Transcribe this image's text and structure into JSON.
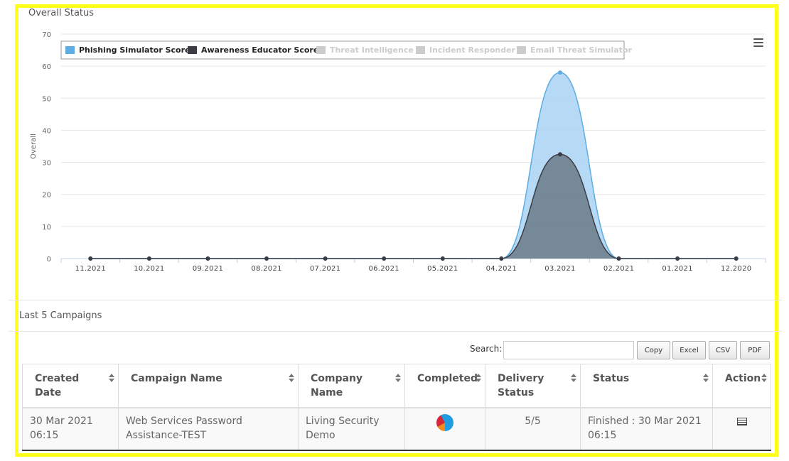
{
  "overall_status": {
    "title": "Overall Status",
    "menu_icon": "hamburger-menu-icon"
  },
  "chart_data": {
    "type": "area",
    "ylabel": "Overall",
    "ylim": [
      0,
      70
    ],
    "yticks": [
      0,
      10,
      20,
      30,
      40,
      50,
      60,
      70
    ],
    "categories": [
      "11.2021",
      "10.2021",
      "09.2021",
      "08.2021",
      "07.2021",
      "06.2021",
      "05.2021",
      "04.2021",
      "03.2021",
      "02.2021",
      "01.2021",
      "12.2020"
    ],
    "legend": {
      "position": "top-left",
      "items": [
        {
          "name": "Phishing Simulator Score",
          "color": "#5dade2",
          "visible": true
        },
        {
          "name": "Awareness Educator Score",
          "color": "#3c3c44",
          "visible": true
        },
        {
          "name": "Threat Intelligence",
          "color": "#cccccc",
          "visible": false
        },
        {
          "name": "Incident Responder",
          "color": "#cccccc",
          "visible": false
        },
        {
          "name": "Email Threat Simulator",
          "color": "#cccccc",
          "visible": false
        }
      ]
    },
    "series": [
      {
        "name": "Phishing Simulator Score",
        "color": "#5dade2",
        "fill": "#a9d4f5",
        "values": [
          0,
          0,
          0,
          0,
          0,
          0,
          0,
          0,
          58,
          0,
          0,
          0
        ]
      },
      {
        "name": "Awareness Educator Score",
        "color": "#3c3c44",
        "fill": "#6f7f8e",
        "values": [
          0,
          0,
          0,
          0,
          0,
          0,
          0,
          0,
          32.5,
          0,
          0,
          0
        ]
      }
    ],
    "grid": true
  },
  "campaigns": {
    "title": "Last 5 Campaigns",
    "search_label": "Search:",
    "search_value": "",
    "buttons": {
      "copy": "Copy",
      "excel": "Excel",
      "csv": "CSV",
      "pdf": "PDF"
    },
    "columns": [
      "Created Date",
      "Campaign Name",
      "Company Name",
      "Completed",
      "Delivery Status",
      "Status",
      "Action"
    ],
    "rows": [
      {
        "created_date": "30 Mar 2021 06:15",
        "campaign_name": "Web Services Password Assistance-TEST",
        "company_name": "Living Security Demo",
        "completed_icon": "pie-chart-icon",
        "delivery_status": "5/5",
        "status": "Finished : 30 Mar 2021 06:15",
        "action_icon": "report-list-icon"
      }
    ]
  }
}
